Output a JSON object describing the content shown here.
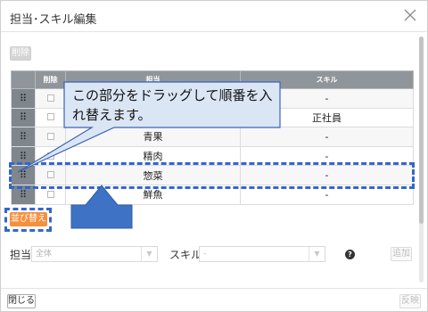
{
  "dialog": {
    "title": "担当･スキル編集"
  },
  "toolbar": {
    "delete_label": "削除"
  },
  "table": {
    "headers": {
      "handle": "",
      "delete": "削除",
      "tantou": "担当",
      "skill": "スキル"
    },
    "rows": [
      {
        "tantou": "",
        "skill": "-"
      },
      {
        "tantou": "",
        "skill": "正社員"
      },
      {
        "tantou": "青果",
        "skill": "-"
      },
      {
        "tantou": "精肉",
        "skill": "-"
      },
      {
        "tantou": "惣菜",
        "skill": "-"
      },
      {
        "tantou": "鮮魚",
        "skill": "-"
      }
    ]
  },
  "sort_button": {
    "label": "並び替え"
  },
  "filters": {
    "tantou_label": "担当",
    "tantou_value": "全体",
    "skill_label": "スキル",
    "skill_value": "-",
    "help": "?",
    "add_label": "追加"
  },
  "footer": {
    "close_label": "閉じる",
    "apply_label": "反映"
  },
  "annotation": {
    "callout": "この部分をドラッグして順番を入れ替えます。"
  },
  "colors": {
    "accent_blue": "#3366cc",
    "callout_fill": "#dbe6f5",
    "sort_orange": "#f5903d"
  },
  "icons": {
    "handle": "drag-handle-icon",
    "close": "close-icon",
    "arrow": "chevron-down-icon",
    "help": "help-icon"
  }
}
